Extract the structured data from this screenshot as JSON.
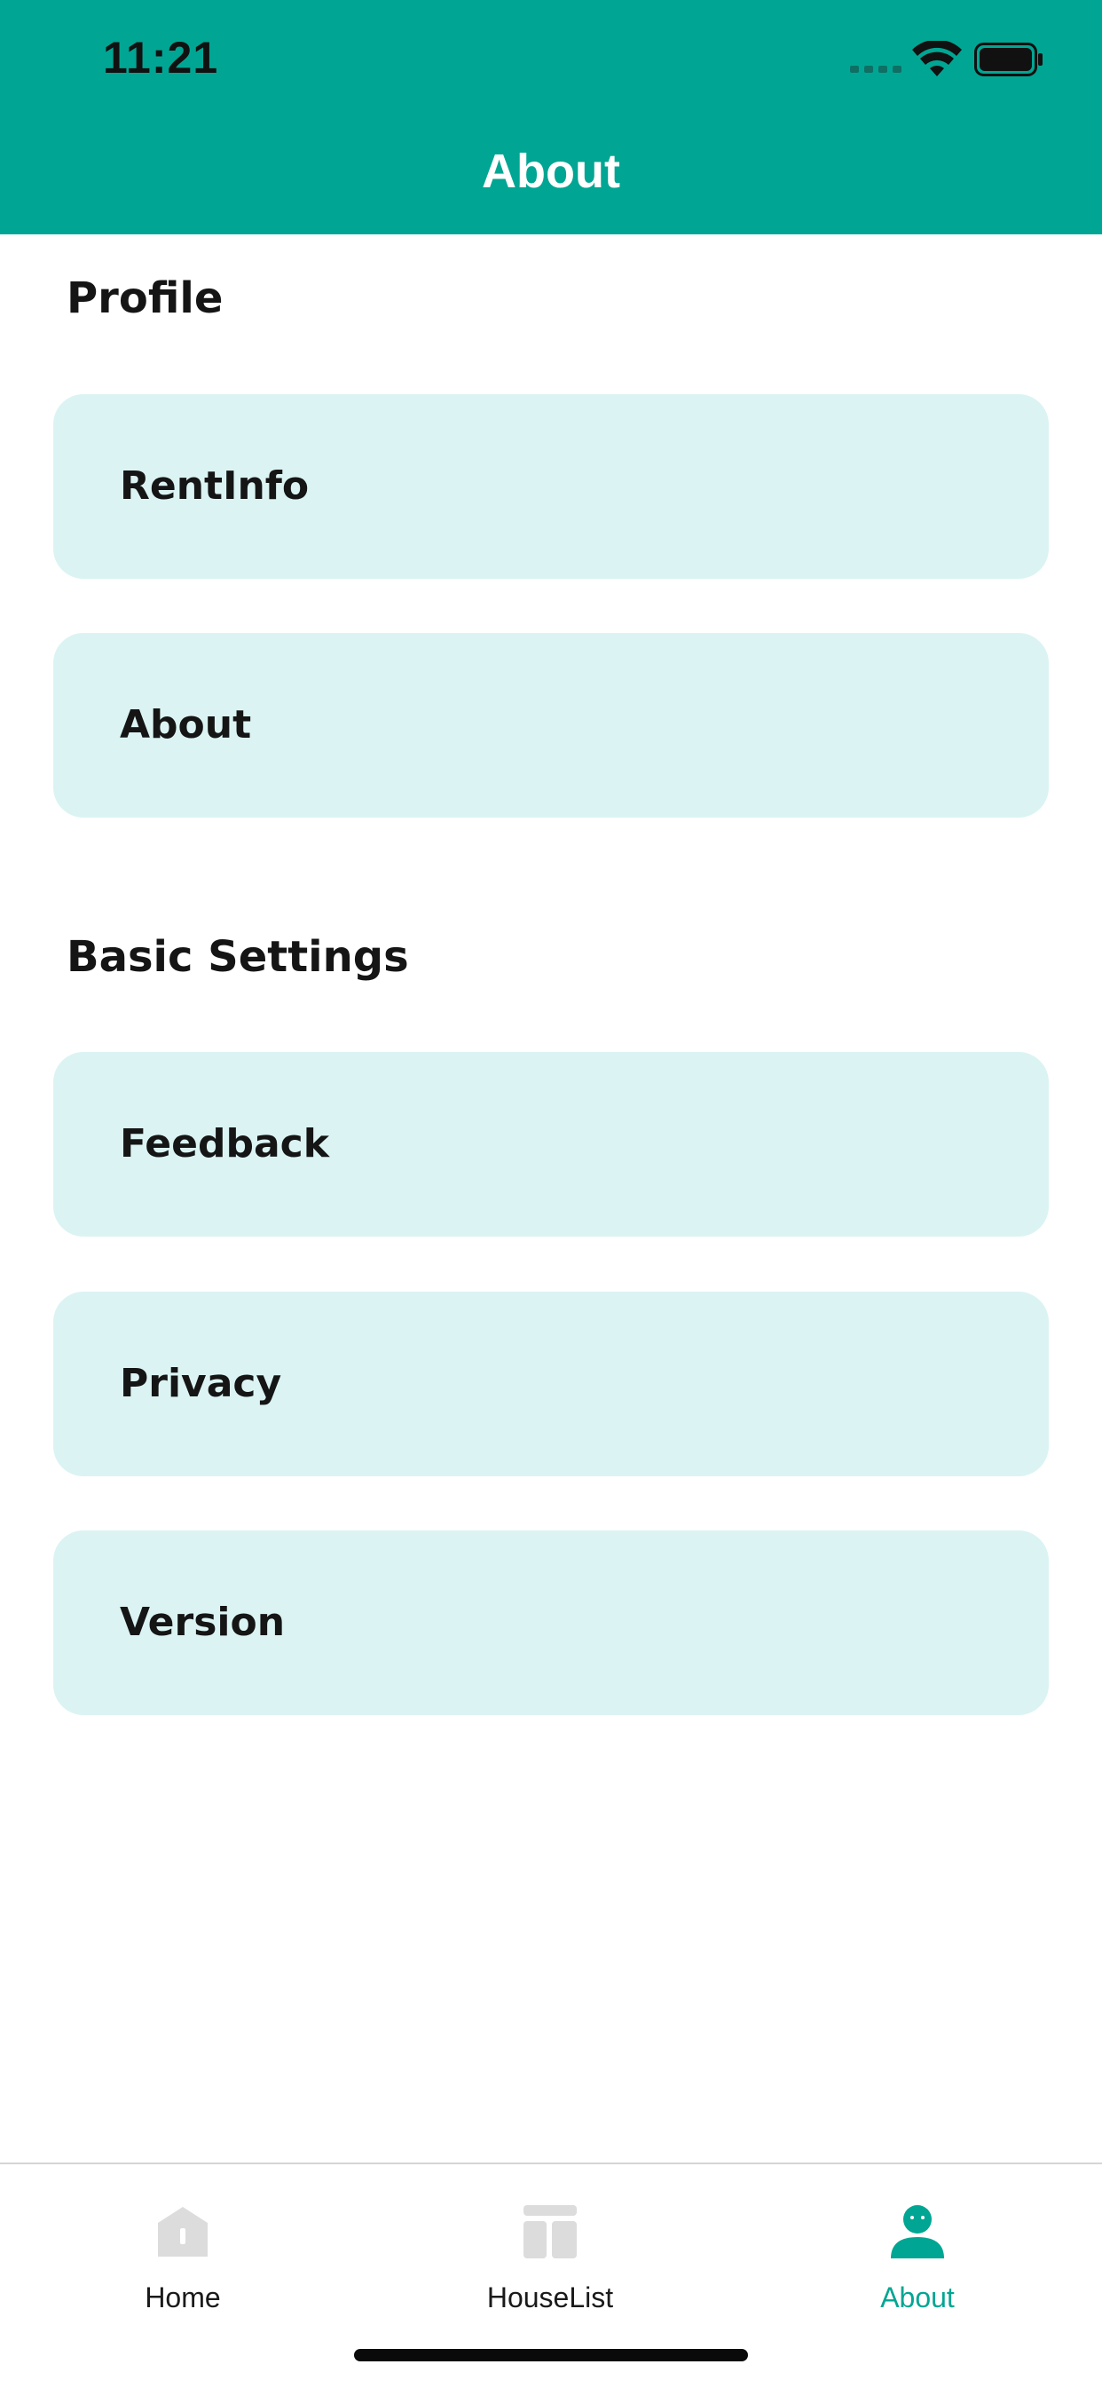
{
  "status_bar": {
    "time": "11:21"
  },
  "header": {
    "title": "About",
    "background_color": "#00a693"
  },
  "sections": [
    {
      "title": "Profile",
      "items": [
        {
          "label": "RentInfo"
        },
        {
          "label": "About"
        }
      ]
    },
    {
      "title": "Basic Settings",
      "items": [
        {
          "label": "Feedback"
        },
        {
          "label": "Privacy"
        },
        {
          "label": "Version"
        }
      ]
    }
  ],
  "card_color": "#dbf4f3",
  "tabbar": {
    "tabs": [
      {
        "label": "Home",
        "icon": "home-icon"
      },
      {
        "label": "HouseList",
        "icon": "list-layout-icon"
      },
      {
        "label": "About",
        "icon": "person-icon",
        "active": true
      }
    ],
    "active_color": "#00a693",
    "inactive_icon_color": "#dcdcdc"
  }
}
